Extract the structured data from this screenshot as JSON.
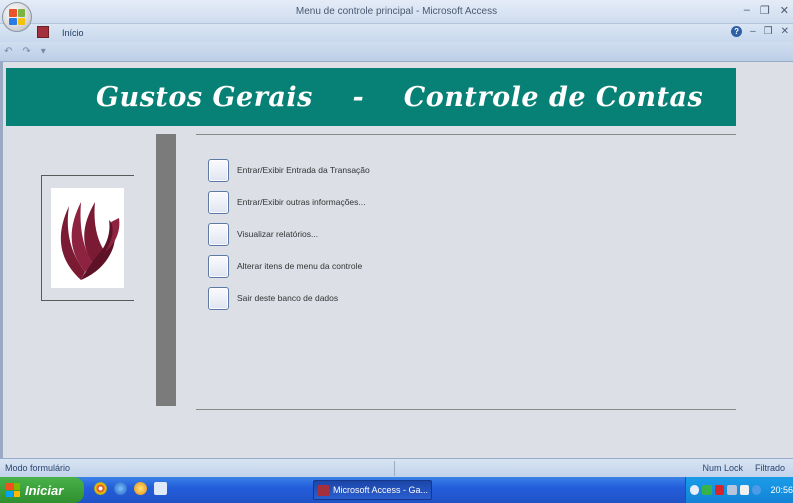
{
  "window": {
    "title": "Menu de controle principal - Microsoft Access",
    "minimize_glyph": "–",
    "restore_glyph": "❐",
    "close_glyph": "✕"
  },
  "ribbon": {
    "tab_home": "Início",
    "help_glyph": "?"
  },
  "qat": {
    "undo_glyph": "↶",
    "redo_glyph": "↷",
    "customize_glyph": "▾"
  },
  "form": {
    "title": "Gustos Gerais    -    Controle de Contas",
    "menu_items": [
      {
        "label": "Entrar/Exibir Entrada da Transação"
      },
      {
        "label": "Entrar/Exibir outras informações..."
      },
      {
        "label": "Visualizar relatórios..."
      },
      {
        "label": "Alterar itens de menu da controle"
      },
      {
        "label": "Sair deste banco de dados"
      }
    ]
  },
  "statusbar": {
    "mode": "Modo formulário",
    "num_lock": "Num Lock",
    "filter": "Filtrado"
  },
  "taskbar": {
    "start_label": "Iniciar",
    "task_label": "Microsoft Access - Ga...",
    "clock": "20:56"
  },
  "colors": {
    "header_bg": "#078075",
    "header_text": "#ffffff",
    "logo_maroon": "#7a1a33"
  }
}
